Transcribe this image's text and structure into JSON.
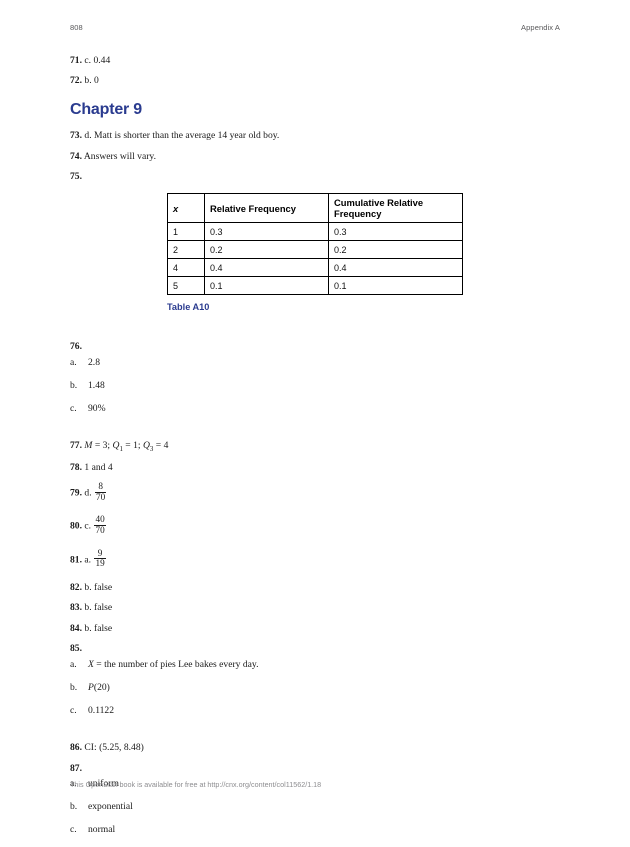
{
  "header": {
    "page_number": "808",
    "section_label": "Appendix A"
  },
  "answers_before_chapter": [
    {
      "num": "71.",
      "text": "c. 0.44"
    },
    {
      "num": "72.",
      "text": "b. 0"
    }
  ],
  "chapter_heading": "Chapter 9",
  "answers_after_chapter": [
    {
      "num": "73.",
      "text": "d. Matt is shorter than the average 14 year old boy."
    },
    {
      "num": "74.",
      "text": "Answers will vary."
    },
    {
      "num": "75.",
      "text": ""
    }
  ],
  "table": {
    "caption": "Table A10",
    "columns": [
      "x",
      "Relative Frequency",
      "Cumulative Relative Frequency"
    ],
    "rows": [
      [
        "1",
        "0.3",
        "0.3"
      ],
      [
        "2",
        "0.2",
        "0.2"
      ],
      [
        "4",
        "0.4",
        "0.4"
      ],
      [
        "5",
        "0.1",
        "0.1"
      ]
    ]
  },
  "item76": {
    "num": "76.",
    "parts": [
      {
        "marker": "a.",
        "text": "2.8"
      },
      {
        "marker": "b.",
        "text": "1.48"
      },
      {
        "marker": "c.",
        "text": "90%"
      }
    ]
  },
  "item77": {
    "num": "77.",
    "m_var": "M",
    "m_val": "= 3;",
    "q1_var": "Q",
    "q1_sub": "1",
    "q1_val": "= 1;",
    "q3_var": "Q",
    "q3_sub": "3",
    "q3_val": "= 4"
  },
  "item78": {
    "num": "78.",
    "text": "1 and 4"
  },
  "item79": {
    "num": "79.",
    "choice": "d.",
    "numerator": "8",
    "denominator": "70"
  },
  "item80": {
    "num": "80.",
    "choice": "c.",
    "numerator": "40",
    "denominator": "70"
  },
  "item81": {
    "num": "81.",
    "choice": "a.",
    "numerator": "9",
    "denominator": "19"
  },
  "item82": {
    "num": "82.",
    "text": "b. false"
  },
  "item83": {
    "num": "83.",
    "text": "b. false"
  },
  "item84": {
    "num": "84.",
    "text": "b. false"
  },
  "item85": {
    "num": "85.",
    "parts": [
      {
        "marker": "a.",
        "var": "X",
        "text": "= the number of pies Lee bakes every day."
      },
      {
        "marker": "b.",
        "var": "P",
        "text": "(20)"
      },
      {
        "marker": "c.",
        "var": "",
        "text": "0.1122"
      }
    ]
  },
  "item86": {
    "num": "86.",
    "text": "CI: (5.25, 8.48)"
  },
  "item87": {
    "num": "87.",
    "parts": [
      {
        "marker": "a.",
        "text": "uniform"
      },
      {
        "marker": "b.",
        "text": "exponential"
      },
      {
        "marker": "c.",
        "text": "normal"
      }
    ]
  },
  "footer": {
    "text": "This OpenStax book is available for free at http://cnx.org/content/col11562/1.18"
  },
  "colors": {
    "heading_blue": "#2a3b8f",
    "body_text": "#1a1a1a",
    "runhead_gray": "#58585a",
    "footer_gray": "#8d8d90"
  }
}
